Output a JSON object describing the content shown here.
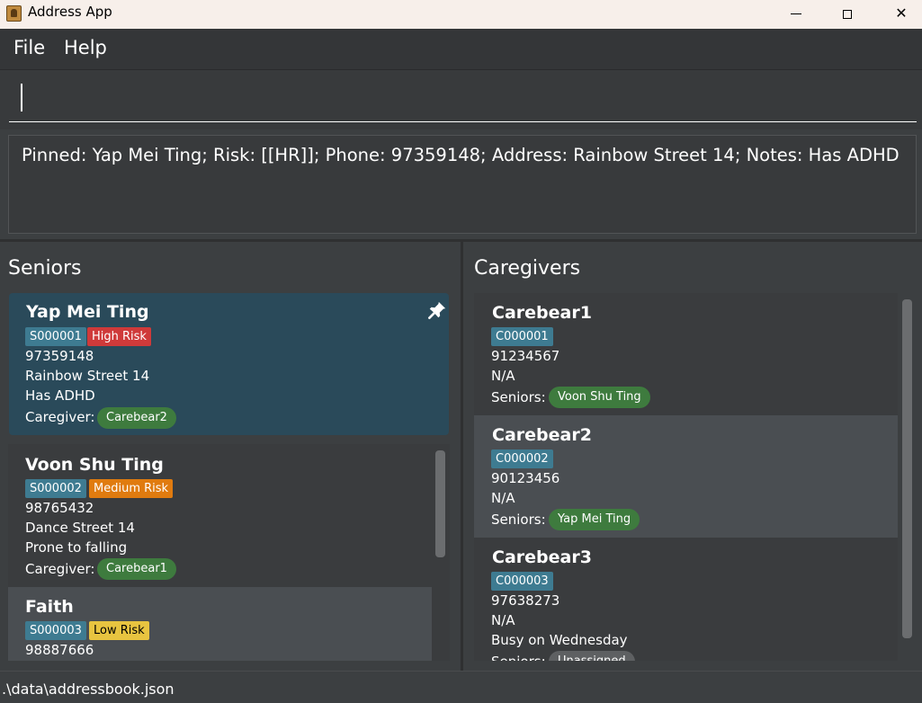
{
  "window": {
    "title": "Address App",
    "close_glyph": "✕"
  },
  "menu": {
    "file": "File",
    "help": "Help"
  },
  "command": {
    "value": ""
  },
  "result": {
    "text": "Pinned: Yap Mei Ting; Risk: [[HR]]; Phone: 97359148; Address: Rainbow Street 14; Notes: Has ADHD"
  },
  "seniors": {
    "title": "Seniors",
    "pinned": {
      "name": "Yap Mei Ting",
      "id": "S000001",
      "risk": "High Risk",
      "phone": "97359148",
      "address": "Rainbow Street 14",
      "note": "Has ADHD",
      "caregiver_label": "Caregiver:",
      "caregiver": "Carebear2"
    },
    "list": [
      {
        "name": "Voon Shu Ting",
        "id": "S000002",
        "risk": "Medium Risk",
        "phone": "98765432",
        "address": "Dance Street 14",
        "note": "Prone to falling",
        "caregiver_label": "Caregiver:",
        "caregiver": "Carebear1"
      },
      {
        "name": "Faith",
        "id": "S000003",
        "risk": "Low Risk",
        "phone": "98887666"
      }
    ]
  },
  "caregivers": {
    "title": "Caregivers",
    "list": [
      {
        "name": "Carebear1",
        "id": "C000001",
        "phone": "91234567",
        "address": "N/A",
        "seniors_label": "Seniors:",
        "senior": "Voon Shu Ting"
      },
      {
        "name": "Carebear2",
        "id": "C000002",
        "phone": "90123456",
        "address": "N/A",
        "seniors_label": "Seniors:",
        "senior": "Yap Mei Ting"
      },
      {
        "name": "Carebear3",
        "id": "C000003",
        "phone": "97638273",
        "address": "N/A",
        "note": "Busy on Wednesday",
        "seniors_label": "Seniors:",
        "senior": "Unassigned"
      }
    ]
  },
  "colors": {
    "high_risk": "#cf3a3a",
    "medium_risk": "#e07b0f",
    "low_risk": "#e8c440",
    "id_tag": "#3e7b91",
    "pill": "#3e7b3e",
    "pinned_card": "#2a4a5a",
    "selected_card": "#4a4e52"
  },
  "status": {
    "path": ".\\data\\addressbook.json"
  }
}
